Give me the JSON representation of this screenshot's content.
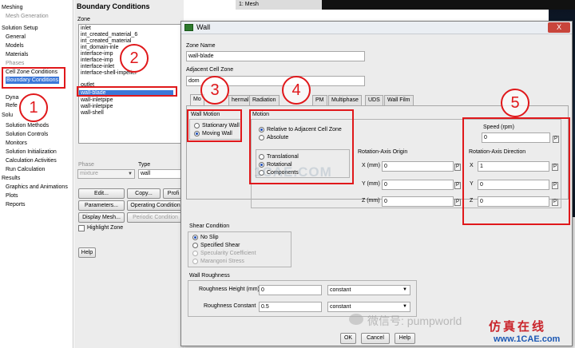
{
  "tree": {
    "meshing": "Meshing",
    "mesh_generation": "Mesh Generation",
    "solution_setup": "Solution Setup",
    "general": "General",
    "models": "Models",
    "materials": "Materials",
    "phases": "Phases",
    "cell_zone_conditions": "Cell Zone Conditions",
    "boundary_conditions": "Boundary Conditions",
    "dynamic": "Dyna",
    "reference": "Refe",
    "solution": "Solu",
    "solution_methods": "Solution Methods",
    "solution_controls": "Solution Controls",
    "monitors": "Monitors",
    "solution_initialization": "Solution Initialization",
    "calculation_activities": "Calculation Activities",
    "run_calculation": "Run Calculation",
    "results": "Results",
    "graphics_animations": "Graphics and Animations",
    "plots": "Plots",
    "reports": "Reports"
  },
  "bc": {
    "title": "Boundary Conditions",
    "zone_label": "Zone",
    "zones": [
      "inlet",
      "int_created_material_6",
      "int_created_material",
      "int_domain-inle",
      "interface-imp",
      "interface-imp",
      "interface-inlet",
      "interface-shell-impeller",
      "outlet",
      "wall-blade",
      "wall-inletpipe",
      "wall-inletpipe",
      "wall-shell"
    ],
    "selected_zone": "wall-blade",
    "phase_label": "Phase",
    "phase_value": "mixture",
    "type_label": "Type",
    "type_value": "wall",
    "edit": "Edit...",
    "copy": "Copy...",
    "profiles": "Profi",
    "parameters": "Parameters...",
    "operating_conditions": "Operating Condition",
    "display_mesh": "Display Mesh...",
    "periodic_conditions": "Periodic Condition",
    "highlight_zone": "Highlight Zone",
    "help": "Help"
  },
  "mesh_window": {
    "tab": "1: Mesh"
  },
  "dialog": {
    "title": "Wall",
    "close": "X",
    "zone_name_label": "Zone Name",
    "zone_name_value": "wall-blade",
    "adjacent_label": "Adjacent Cell Zone",
    "adjacent_value": "dom",
    "tabs": [
      "Mo",
      "hermal",
      "Radiation",
      "PM",
      "Multiphase",
      "UDS",
      "Wall Film"
    ],
    "wall_motion_label": "Wall Motion",
    "stationary_wall": "Stationary Wall",
    "moving_wall": "Moving Wall",
    "motion_label": "Motion",
    "relative": "Relative to Adjacent Cell Zone",
    "absolute": "Absolute",
    "translational": "Translational",
    "rotational": "Rotational",
    "components": "Components",
    "speed_label": "Speed (rpm)",
    "speed_value": "0",
    "rao_label": "Rotation-Axis Origin",
    "rao_x_label": "X (mm)",
    "rao_x": "0",
    "rao_y_label": "Y (mm)",
    "rao_y": "0",
    "rao_z_label": "Z (mm)",
    "rao_z": "0",
    "rad_label": "Rotation-Axis Direction",
    "rad_x_label": "X",
    "rad_x": "1",
    "rad_y_label": "Y",
    "rad_y": "0",
    "rad_z_label": "Z",
    "rad_z": "0",
    "p": "P",
    "shear_label": "Shear Condition",
    "no_slip": "No Slip",
    "specified_shear": "Specified Shear",
    "specularity": "Specularity Coefficient",
    "marangoni": "Marangoni Stress",
    "roughness_label": "Wall Roughness",
    "rough_height_label": "Roughness Height (mm)",
    "rough_height": "0",
    "rough_const_label": "Roughness Constant",
    "rough_const": "0.5",
    "constant": "constant",
    "ok": "OK",
    "cancel": "Cancel",
    "help": "Help"
  },
  "annotations": {
    "b1": "1",
    "b2": "2",
    "b3": "3",
    "b4": "4",
    "b5": "5"
  },
  "watermarks": {
    "center": "1CAE.COM",
    "wechat": "微信号: pumpworld",
    "brand_cn": "仿真在线",
    "brand_url": "www.1CAE.com"
  },
  "colors": {
    "annotation_red": "#e0181b",
    "selection_blue": "#3c78d8"
  }
}
